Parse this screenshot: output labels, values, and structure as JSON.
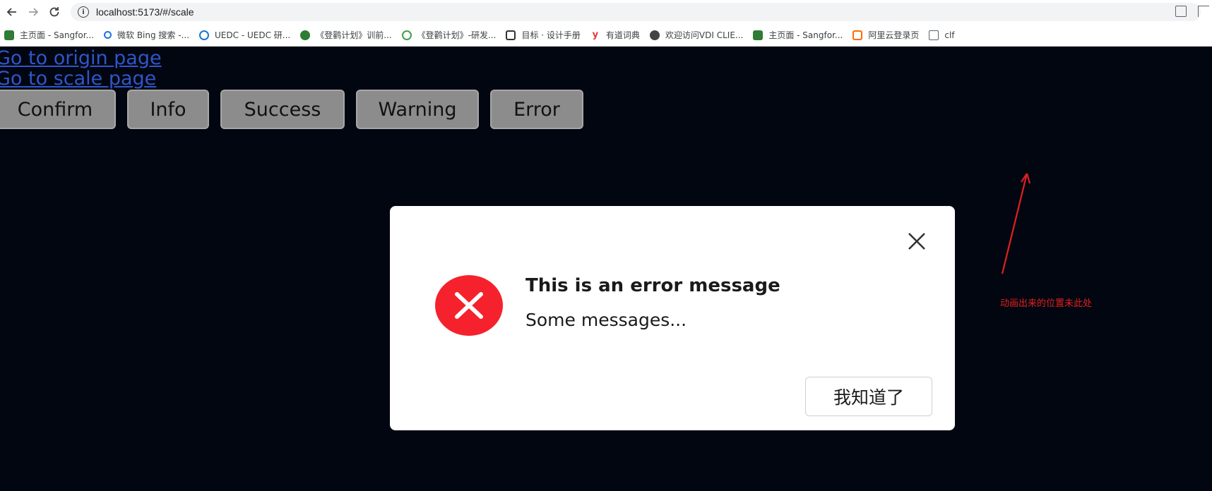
{
  "browser": {
    "url": "localhost:5173/#/scale",
    "bookmarks": [
      {
        "label": "主页面 - Sangfor...",
        "icon": "sangfor-icon",
        "color": "#2e7d32"
      },
      {
        "label": "微软 Bing 搜索 -...",
        "icon": "search-icon",
        "color": "#1a73e8"
      },
      {
        "label": "UEDC - UEDC 研...",
        "icon": "uedc-icon",
        "color": "#1976d2"
      },
      {
        "label": "《登鹳计划》训前...",
        "icon": "globe-icon",
        "color": "#2e7d32"
      },
      {
        "label": "《登鹳计划》-研发...",
        "icon": "shield-icon",
        "color": "#43a047"
      },
      {
        "label": "目标 · 设计手册",
        "icon": "book-icon",
        "color": "#333333"
      },
      {
        "label": "有道词典",
        "icon": "youdao-icon",
        "color": "#e53935"
      },
      {
        "label": "欢迎访问VDI CLIE...",
        "icon": "globe-icon",
        "color": "#444444"
      },
      {
        "label": "主页面 - Sangfor...",
        "icon": "sangfor-icon",
        "color": "#2e7d32"
      },
      {
        "label": "阿里云登录页",
        "icon": "aliyun-icon",
        "color": "#ff6a00"
      },
      {
        "label": "clf",
        "icon": "folder-icon",
        "color": "#5f6368"
      }
    ]
  },
  "page": {
    "links": {
      "origin": "Go to origin page",
      "scale": "Go to scale page"
    },
    "buttons": {
      "confirm": "Confirm",
      "info": "Info",
      "success": "Success",
      "warning": "Warning",
      "error": "Error"
    }
  },
  "modal": {
    "title": "This is an error message",
    "body": "Some messages...",
    "ok_label": "我知道了",
    "icon_color": "#f5222d"
  },
  "annotation": {
    "text": "动画出来的位置未此处",
    "color": "#e0201f"
  }
}
